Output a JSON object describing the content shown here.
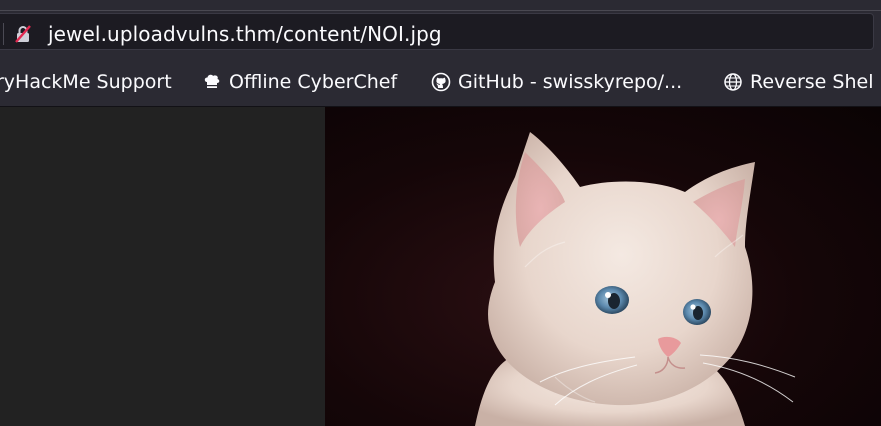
{
  "urlbar": {
    "url": "jewel.uploadvulns.thm/content/NOI.jpg"
  },
  "bookmarks": [
    {
      "label": "ryHackMe Support",
      "icon": "none"
    },
    {
      "label": "Offline CyberChef",
      "icon": "chef-hat-icon"
    },
    {
      "label": "GitHub - swisskyrepo/...",
      "icon": "github-icon"
    },
    {
      "label": "Reverse Shel",
      "icon": "globe-icon"
    }
  ],
  "content": {
    "image_description_alt": "kitten",
    "image_src_name": "NOI.jpg"
  },
  "colors": {
    "toolbar_bg": "#2b2a33",
    "urlbar_bg": "#1c1b22",
    "text": "#fbfbfe",
    "page_bg": "#222222",
    "insecure_red": "#e22850"
  }
}
